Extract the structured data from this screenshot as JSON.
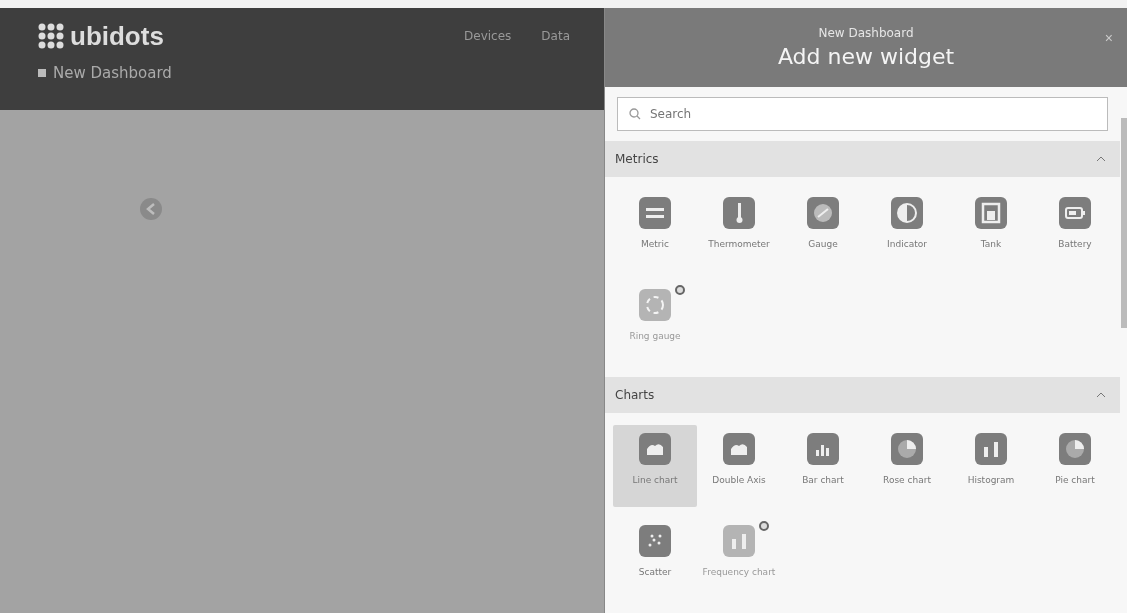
{
  "app": {
    "logo": "ubidots",
    "nav": [
      "Devices",
      "Data"
    ],
    "dashboard": "New Dashboard"
  },
  "panel": {
    "subtitle": "New Dashboard",
    "title": "Add new widget",
    "close": "×",
    "search": {
      "placeholder": "Search"
    },
    "sections": [
      {
        "title": "Metrics",
        "expanded": true,
        "widgets": [
          {
            "label": "Metric",
            "kind": "metric",
            "selected": false,
            "disabled": false
          },
          {
            "label": "Thermometer",
            "kind": "thermo",
            "selected": false,
            "disabled": false
          },
          {
            "label": "Gauge",
            "kind": "gauge",
            "selected": false,
            "disabled": false
          },
          {
            "label": "Indicator",
            "kind": "indicator",
            "selected": false,
            "disabled": false
          },
          {
            "label": "Tank",
            "kind": "tank",
            "selected": false,
            "disabled": false
          },
          {
            "label": "Battery",
            "kind": "battery",
            "selected": false,
            "disabled": false
          },
          {
            "label": "Ring gauge",
            "kind": "ring",
            "selected": false,
            "disabled": true
          }
        ]
      },
      {
        "title": "Charts",
        "expanded": true,
        "widgets": [
          {
            "label": "Line chart",
            "kind": "line",
            "selected": true,
            "disabled": false
          },
          {
            "label": "Double Axis",
            "kind": "line",
            "selected": false,
            "disabled": false
          },
          {
            "label": "Bar chart",
            "kind": "bar",
            "selected": false,
            "disabled": false
          },
          {
            "label": "Rose chart",
            "kind": "pie",
            "selected": false,
            "disabled": false
          },
          {
            "label": "Histogram",
            "kind": "histogram",
            "selected": false,
            "disabled": false
          },
          {
            "label": "Pie chart",
            "kind": "pie",
            "selected": false,
            "disabled": false
          },
          {
            "label": "Scatter",
            "kind": "scatter",
            "selected": false,
            "disabled": false
          },
          {
            "label": "Frequency chart",
            "kind": "histogram",
            "selected": false,
            "disabled": true
          }
        ]
      }
    ]
  }
}
